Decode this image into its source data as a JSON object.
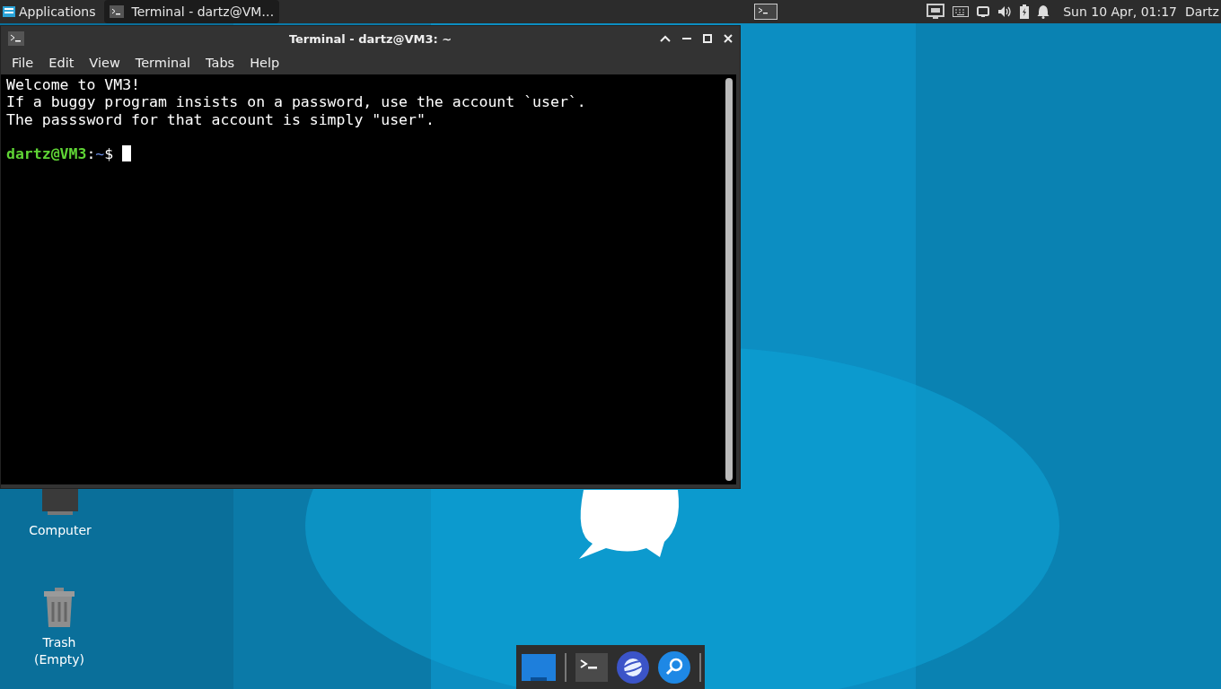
{
  "top_panel": {
    "applications": "Applications",
    "task": {
      "title": "Terminal - dartz@VM…",
      "selected": true
    },
    "clock": "Sun 10 Apr, 01:17",
    "user": "Dartz"
  },
  "window": {
    "title": "Terminal - dartz@VM3: ~",
    "menu": [
      "File",
      "Edit",
      "View",
      "Terminal",
      "Tabs",
      "Help"
    ],
    "lines": [
      "Welcome to VM3!",
      "If a buggy program insists on a password, use the account `user`.",
      "The passsword for that account is simply \"user\"."
    ],
    "prompt": {
      "user_host": "dartz@VM3",
      "separator": ":",
      "path": "~",
      "symbol": "$"
    }
  },
  "desktop_icons": [
    {
      "kind": "computer",
      "label": "Computer"
    },
    {
      "kind": "trash",
      "label": "Trash (Empty)"
    }
  ]
}
